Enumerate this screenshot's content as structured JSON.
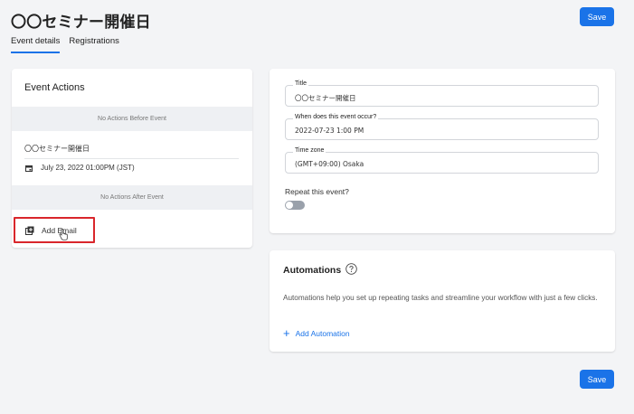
{
  "header": {
    "title": "〇〇セミナー開催日",
    "save_label": "Save"
  },
  "tabs": [
    {
      "label": "Event details",
      "active": true
    },
    {
      "label": "Registrations",
      "active": false
    }
  ],
  "event_actions": {
    "title": "Event Actions",
    "before_label": "No Actions Before Event",
    "event_name": "〇〇セミナー開催日",
    "event_date": "July 23, 2022 01:00PM (JST)",
    "after_label": "No Actions After Event",
    "add_email_label": "Add Email"
  },
  "form": {
    "title": {
      "label": "Title",
      "value": "〇〇セミナー開催日"
    },
    "when": {
      "label": "When does this event occur?",
      "value": "2022-07-23 1:00 PM"
    },
    "timezone": {
      "label": "Time zone",
      "value": "(GMT+09:00) Osaka"
    },
    "repeat_label": "Repeat this event?",
    "repeat_enabled": false
  },
  "automations": {
    "title": "Automations",
    "description": "Automations help you set up repeating tasks and streamline your workflow with just a few clicks.",
    "add_label": "Add Automation"
  },
  "footer": {
    "save_label": "Save"
  },
  "colors": {
    "accent": "#1a73e8",
    "highlight": "#d9262b"
  }
}
